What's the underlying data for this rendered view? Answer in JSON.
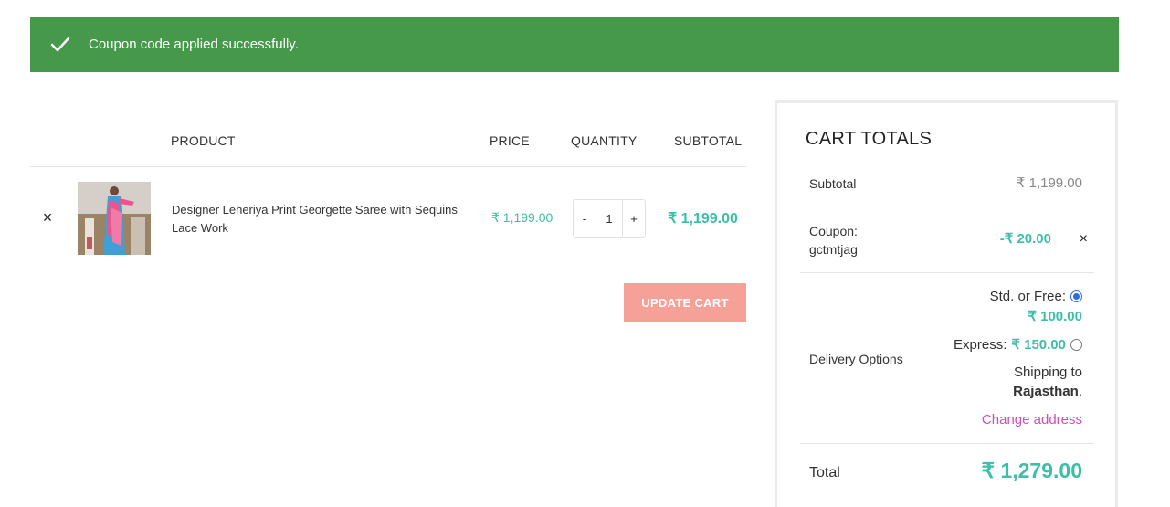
{
  "notice": {
    "message": "Coupon code applied successfully.",
    "icon": "check-icon",
    "color": "#46994a"
  },
  "table": {
    "headers": {
      "product": "PRODUCT",
      "price": "PRICE",
      "quantity": "QUANTITY",
      "subtotal": "SUBTOTAL"
    },
    "items": [
      {
        "remove": "×",
        "name": "Designer Leheriya Print Georgette Saree with Sequins Lace Work",
        "price": "₹ 1,199.00",
        "quantity": "1",
        "minus": "-",
        "plus": "+",
        "subtotal": "₹ 1,199.00"
      }
    ],
    "update_label": "UPDATE CART"
  },
  "totals": {
    "title": "CART TOTALS",
    "subtotal_label": "Subtotal",
    "subtotal_value": "₹ 1,199.00",
    "coupon_label": "Coupon:",
    "coupon_code": "gctmtjag",
    "coupon_value": "-₹ 20.00",
    "coupon_remove": "×",
    "delivery_label": "Delivery Options",
    "options": [
      {
        "label": "Std. or Free:",
        "price": "₹ 100.00",
        "selected": true
      },
      {
        "label": "Express:",
        "price": "₹ 150.00",
        "selected": false
      }
    ],
    "shipping_to": "Shipping to",
    "shipping_region": "Rajasthan",
    "shipping_period": ".",
    "change_address": "Change address",
    "total_label": "Total",
    "total_value": "₹ 1,279.00"
  },
  "colors": {
    "accent": "#3cbfa8",
    "update_button": "#f6a197",
    "link": "#d44fb0"
  }
}
